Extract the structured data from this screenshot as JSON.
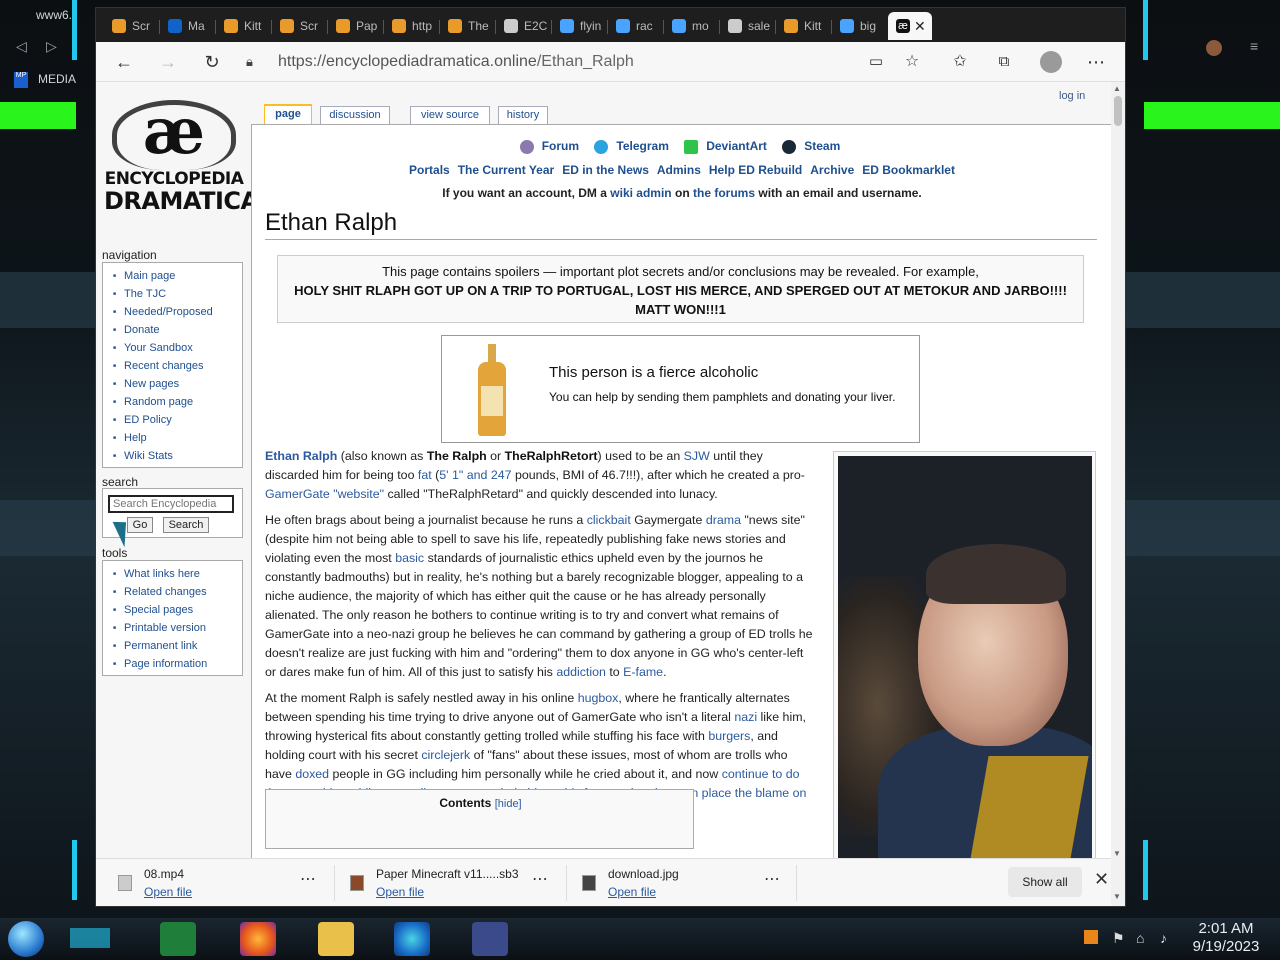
{
  "desktop": {
    "top_left_label": "www6.",
    "media_label": "MEDIA"
  },
  "tabs": [
    {
      "label": "Scr",
      "icon": "bookmark-icon",
      "color": "#e89b2b"
    },
    {
      "label": "Ma",
      "icon": "outlook-icon",
      "color": "#1064c9"
    },
    {
      "label": "Kitt",
      "icon": "bookmark-icon",
      "color": "#e89b2b"
    },
    {
      "label": "Scr",
      "icon": "bookmark-icon",
      "color": "#e89b2b"
    },
    {
      "label": "Pap",
      "icon": "bookmark-icon",
      "color": "#e89b2b"
    },
    {
      "label": "http",
      "icon": "bookmark-icon",
      "color": "#e89b2b"
    },
    {
      "label": "The",
      "icon": "bookmark-icon",
      "color": "#e89b2b"
    },
    {
      "label": "E2C",
      "icon": "document-icon",
      "color": "#cccccc"
    },
    {
      "label": "flyin",
      "icon": "search-icon",
      "color": "#4aa3ff"
    },
    {
      "label": "rac",
      "icon": "search-icon",
      "color": "#4aa3ff"
    },
    {
      "label": "mo",
      "icon": "search-icon",
      "color": "#4aa3ff"
    },
    {
      "label": "sale",
      "icon": "document-icon",
      "color": "#cccccc"
    },
    {
      "label": "Kitt",
      "icon": "bookmark-icon",
      "color": "#e89b2b"
    },
    {
      "label": "big",
      "icon": "search-icon",
      "color": "#4aa3ff"
    }
  ],
  "address": {
    "host": "https://encyclopediadramatica.online",
    "path": "/Ethan_Ralph"
  },
  "page": {
    "login": "log in",
    "logo_line1": "ENCYCLOPEDIA",
    "logo_line2": "DRAMATICA",
    "logo_ae": "æ",
    "tabs": [
      "page",
      "discussion",
      "view source",
      "history"
    ],
    "nav_heading": "navigation",
    "nav_items": [
      "Main page",
      "The TJC",
      "Needed/Proposed",
      "Donate",
      "Your Sandbox",
      "Recent changes",
      "New pages",
      "Random page",
      "ED Policy",
      "Help",
      "Wiki Stats"
    ],
    "search_heading": "search",
    "search_placeholder": "Search Encyclopedia",
    "go_label": "Go",
    "search_label": "Search",
    "tools_heading": "tools",
    "tools_items": [
      "What links here",
      "Related changes",
      "Special pages",
      "Printable version",
      "Permanent link",
      "Page information"
    ],
    "social": [
      "Forum",
      "Telegram",
      "DeviantArt",
      "Steam"
    ],
    "sitelinks": [
      "Portals",
      "The Current Year",
      "ED in the News",
      "Admins",
      "Help ED Rebuild",
      "Archive",
      "ED Bookmarklet"
    ],
    "notice_pre": "If you want an account, DM a",
    "notice_link1": "wiki admin",
    "notice_mid": "on",
    "notice_link2": "the forums",
    "notice_post": "with an email and username.",
    "title": "Ethan Ralph",
    "spoiler_line": "This page contains spoilers — important plot secrets and/or conclusions may be revealed. For example,",
    "spoiler_big": "HOLY SHIT RLAPH GOT UP ON A TRIP TO PORTUGAL, LOST HIS MERCE, AND SPERGED OUT AT METOKUR AND JARBO!!!! MATT WON!!!1",
    "alco_title": "This person is a fierce alcoholic",
    "alco_sub": "You can help by sending them pamphlets and donating your liver.",
    "toc_title": "Contents",
    "toc_hide": "[hide]"
  },
  "article": {
    "p1": {
      "a": "Ethan Ralph",
      "b": " (also known as ",
      "c": "The Ralph",
      "d": " or ",
      "e": "TheRalphRetort",
      "f": ") used to be an ",
      "g": "SJW",
      "h": " until they discarded him for being too ",
      "i": "fat",
      "j": " (",
      "k": "5' 1\" and 247",
      "l": " pounds, BMI of 46.7!!!), after which he created a pro-",
      "m": "GamerGate",
      "n": " ",
      "o": "\"website\"",
      "p": " called \"TheRalphRetard\" and quickly descended into lunacy."
    },
    "p2": {
      "a": "He often brags about being a journalist because he runs a ",
      "b": "clickbait",
      "c": " Gaymergate ",
      "d": "drama",
      "e": " \"news site\" (despite him not being able to spell to save his life, repeatedly publishing fake news stories and violating even the most ",
      "f": "basic",
      "g": " standards of journalistic ethics upheld even by the journos he constantly badmouths) but in reality, he's nothing but a barely recognizable blogger, appealing to a niche audience, the majority of which has either quit the cause or he has already personally alienated. The only reason he bothers to continue writing is to try and convert what remains of GamerGate into a neo-nazi group he believes he can command by gathering a group of ED trolls he doesn't realize are just fucking with him and \"ordering\" them to dox anyone in GG who's center-left or dares make fun of him. All of this just to satisfy his ",
      "h": "addiction",
      "i": " to ",
      "j": "E-fame",
      "k": "."
    },
    "p3": {
      "a": "At the moment Ralph is safely nestled away in his online ",
      "b": "hugbox",
      "c": ", where he frantically alternates between spending his time trying to drive anyone out of GamerGate who isn't a literal ",
      "d": "nazi",
      "e": " like him, throwing hysterical fits about constantly getting trolled while stuffing his face with ",
      "f": "burgers",
      "g": ", and holding court with his secret ",
      "h": "circlejerk",
      "i": " of \"fans\" about these issues, most of whom are trolls who have ",
      "j": "doxed",
      "k": " people in GG including him personally while he cried about it, and now ",
      "l": "continue to do the same thing while pretending to want to help him to his face so that they can place the blame on him for more drama and then laugh at him behind his back",
      "m": "."
    }
  },
  "downloads": [
    {
      "name": "08.mp4",
      "action": "Open file"
    },
    {
      "name": "Paper Minecraft v11.....sb3",
      "action": "Open file"
    },
    {
      "name": "download.jpg",
      "action": "Open file"
    }
  ],
  "downloads_show_all": "Show all",
  "clock": {
    "time": "2:01 AM",
    "date": "9/19/2023"
  },
  "colors": {
    "link": "#2b5aa0",
    "accent_green": "#29f51d",
    "frame_cyan": "#22c7ee"
  }
}
